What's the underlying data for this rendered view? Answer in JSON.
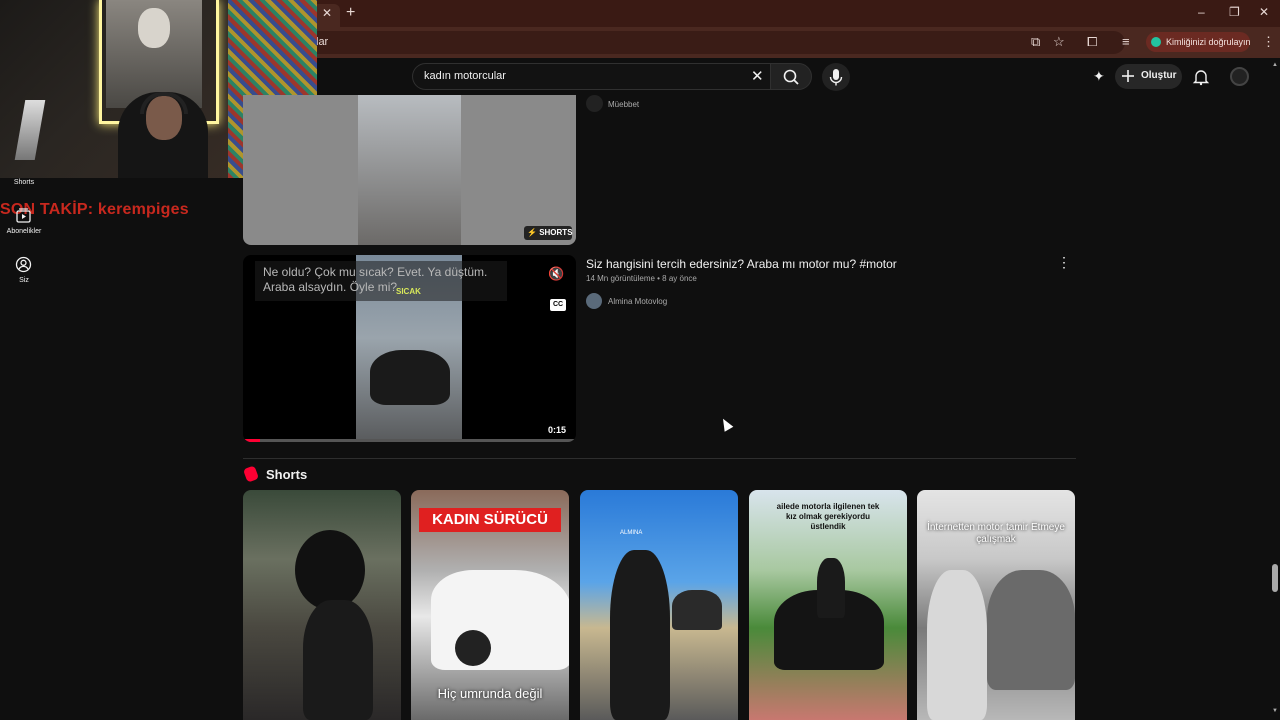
{
  "browser": {
    "tab_close_icon": "close-icon",
    "new_tab_symbol": "+",
    "address_fragment": "lar",
    "verify_identity_label": "Kimliğinizi doğrulayın",
    "window_controls": {
      "minimize": "–",
      "restore": "❐",
      "close": "✕"
    }
  },
  "header": {
    "search_value": "kadın motorcular",
    "clear_symbol": "✕",
    "create_label": "Oluştur"
  },
  "overlay": {
    "follow_text": "SON TAKİP: kerempiges"
  },
  "sidebar": {
    "items": [
      {
        "label": "Shorts",
        "icon": "shorts-icon"
      },
      {
        "label": "Abonelikler",
        "icon": "subscriptions-icon"
      },
      {
        "label": "Siz",
        "icon": "account-icon"
      }
    ]
  },
  "results": {
    "video1": {
      "channel": "Müebbet",
      "badge": "SHORTS"
    },
    "video2": {
      "title": "Siz hangisini tercih edersiniz? Araba mı motor mu? #motor",
      "meta": "14 Mn görüntüleme • 8 ay önce",
      "channel": "Almina Motovlog",
      "caption_line1": "Ne oldu? Çok mu sıcak? Evet. Ya düştüm.",
      "caption_line2": "Araba alsaydın. Öyle mi?",
      "tag": "SICAK",
      "cc_label": "CC",
      "duration": "0:15",
      "progress_fraction": 0.05
    }
  },
  "shorts_section": {
    "heading": "Shorts",
    "items": [
      {
        "overlay": ""
      },
      {
        "banner": "KADIN SÜRÜCÜ",
        "overlay": "Hiç umrunda değil"
      },
      {
        "overlay": "ALMINA"
      },
      {
        "overlay": "ailede motorla ilgilenen tek kız olmak gerekiyordu üstlendik"
      },
      {
        "overlay": "İnternetten motor tamir Etmeye çalışmak"
      }
    ]
  },
  "colors": {
    "accent": "#ff0033",
    "overlay_red": "#c8281e",
    "tabstrip": "#3a1a14"
  }
}
